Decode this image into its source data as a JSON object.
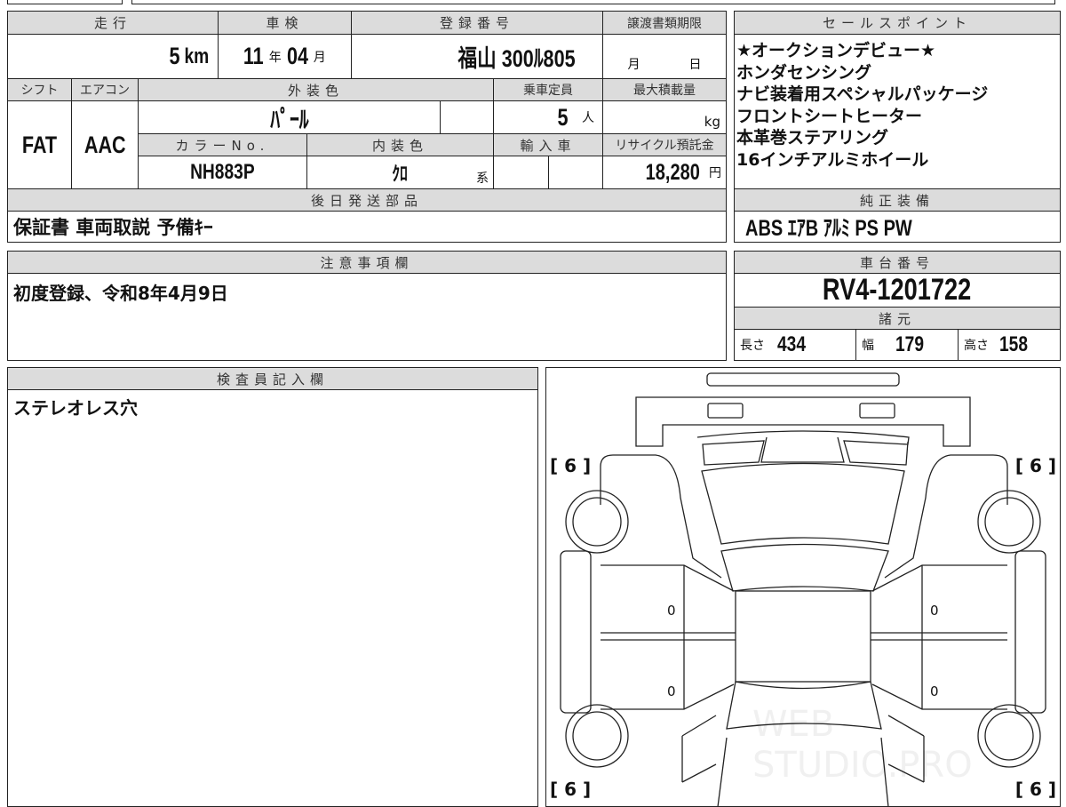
{
  "top": {
    "mileage_label": "走行",
    "mileage_value": "5",
    "mileage_unit": "km",
    "shaken_label": "車検",
    "shaken_year": "11",
    "shaken_year_unit": "年",
    "shaken_month": "04",
    "shaken_month_unit": "月",
    "plate_label": "登録番号",
    "plate_value": "福山 300ﾙ805",
    "transfer_label": "譲渡書類期限",
    "transfer_month": "月",
    "transfer_day": "日",
    "shift_label": "シフト",
    "shift_value": "FAT",
    "ac_label": "エアコン",
    "ac_value": "AAC",
    "exterior_label": "外装色",
    "exterior_value": "ﾊﾟｰﾙ",
    "capacity_label": "乗車定員",
    "capacity_value": "5",
    "capacity_unit": "人",
    "load_label": "最大積載量",
    "load_unit": "kg",
    "colorno_label": "カラーNo.",
    "colorno_value": "NH883P",
    "interior_label": "内装色",
    "interior_value": "ｸﾛ",
    "interior_unit": "系",
    "import_label": "輸入車",
    "recycle_label": "リサイクル預託金",
    "recycle_value": "18,280",
    "recycle_unit": "円",
    "later_label": "後日発送部品",
    "later_value": "保証書 車両取説 予備ｷｰ"
  },
  "sales": {
    "label": "セールスポイント",
    "items": [
      "★オークションデビュー★",
      "ホンダセンシング",
      "ナビ装着用スペシャルパッケージ",
      "フロントシートヒーター",
      "本革巻ステアリング",
      "16インチアルミホイール"
    ]
  },
  "equipment": {
    "label": "純正装備",
    "value": "ABS ｴｱB ｱﾙﾐ PS PW"
  },
  "notes": {
    "label": "注意事項欄",
    "value": "初度登録、令和8年4月9日"
  },
  "chassis": {
    "label": "車台番号",
    "value": "RV4-1201722"
  },
  "specs": {
    "label": "諸元",
    "length_label": "長さ",
    "length": "434",
    "width_label": "幅",
    "width": "179",
    "height_label": "高さ",
    "height": "158"
  },
  "inspector": {
    "label": "検査員記入欄",
    "value": "ステレオレス穴"
  },
  "diagram": {
    "tire_tl": "[ 6 ]",
    "tire_tr": "[ 6 ]",
    "tire_bl": "[ 6 ]",
    "tire_br": "[ 6 ]",
    "d1": "0",
    "d2": "0",
    "d3": "0",
    "d4": "0",
    "watermark": "WEB STUDIO.PRO"
  }
}
